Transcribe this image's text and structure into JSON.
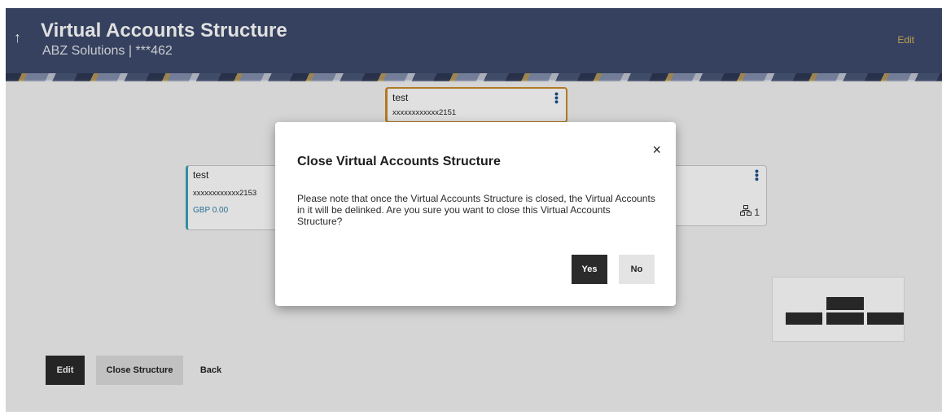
{
  "header": {
    "title": "Virtual Accounts Structure",
    "subtitle": "ABZ Solutions | ***462",
    "edit_label": "Edit",
    "back_icon": "↑"
  },
  "cards": {
    "top": {
      "name": "test",
      "account": "xxxxxxxxxxxx2151"
    },
    "left": {
      "name": "test",
      "account": "xxxxxxxxxxxx2153",
      "balance": "GBP 0.00"
    },
    "right": {
      "child_count": "1"
    }
  },
  "actions": {
    "edit": "Edit",
    "close_structure": "Close Structure",
    "back": "Back"
  },
  "modal": {
    "title": "Close Virtual Accounts Structure",
    "message": "Please note that once the Virtual Accounts Structure is closed, the Virtual Accounts in it will be delinked. Are you sure you want to close this Virtual Accounts Structure?",
    "yes": "Yes",
    "no": "No",
    "close_icon": "×"
  },
  "colors": {
    "header_bg": "#3d4a6b",
    "accent_gold": "#c98a2b",
    "accent_teal": "#3ba1b8",
    "balance_blue": "#2f7fa5",
    "primary_button": "#2b2b2b"
  }
}
